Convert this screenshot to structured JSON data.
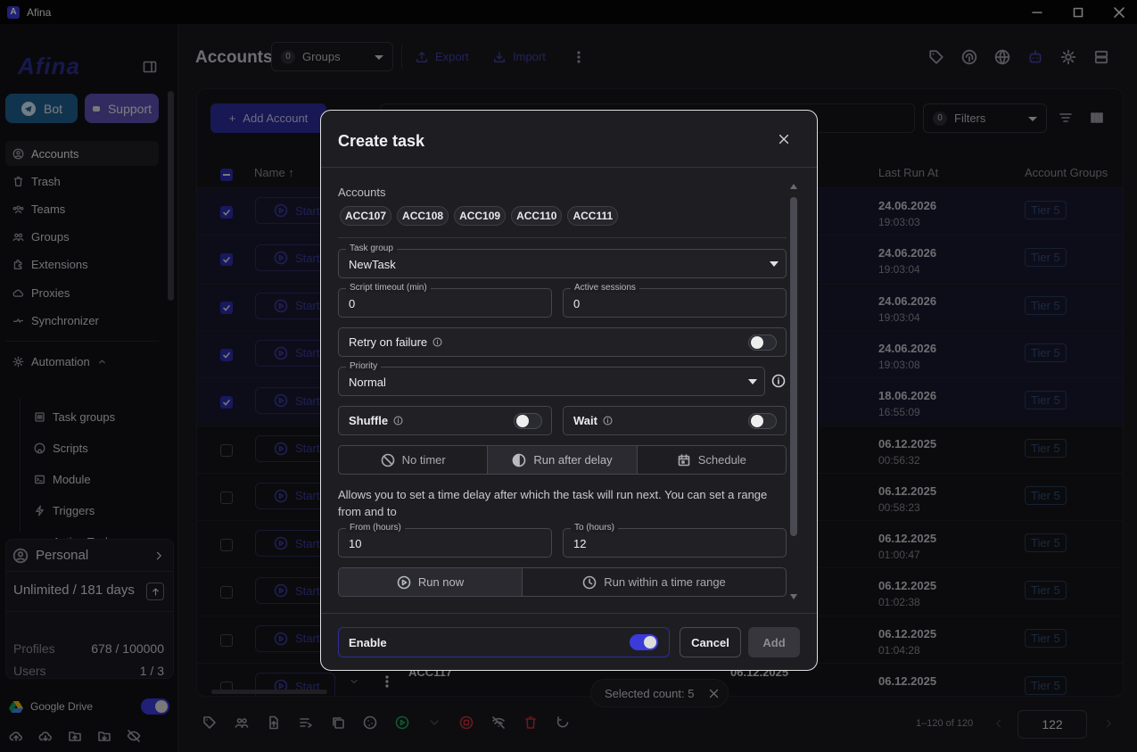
{
  "window": {
    "title": "Afina"
  },
  "sidebar": {
    "brand": "Afina",
    "bot_label": "Bot",
    "support_label": "Support",
    "nav": [
      {
        "label": "Accounts",
        "icon": "user-circle-icon"
      },
      {
        "label": "Trash",
        "icon": "trash-icon"
      },
      {
        "label": "Teams",
        "icon": "teams-icon"
      },
      {
        "label": "Groups",
        "icon": "groups-icon"
      },
      {
        "label": "Extensions",
        "icon": "puzzle-icon"
      },
      {
        "label": "Proxies",
        "icon": "cloud-icon"
      },
      {
        "label": "Synchronizer",
        "icon": "sync-icon"
      }
    ],
    "automation_label": "Automation",
    "automation_items": [
      {
        "label": "Task groups",
        "icon": "list-icon"
      },
      {
        "label": "Scripts",
        "icon": "github-icon"
      },
      {
        "label": "Module",
        "icon": "terminal-icon"
      },
      {
        "label": "Triggers",
        "icon": "bolt-icon"
      },
      {
        "label": "Active Task",
        "icon": "active-list-icon"
      }
    ],
    "plan": {
      "workspace": "Personal",
      "license": "Unlimited / 181 days",
      "profiles_label": "Profiles",
      "profiles_value": "678 / 100000",
      "users_label": "Users",
      "users_value": "1 / 3"
    },
    "google_drive_label": "Google Drive"
  },
  "header": {
    "title": "Accounts",
    "groups_count": "0",
    "groups_label": "Groups",
    "export_label": "Export",
    "import_label": "Import"
  },
  "table": {
    "add_account_label": "Add Account",
    "filters_count": "0",
    "filters_label": "Filters",
    "col_name": "Name ↑",
    "col_last_run": "Last Run At",
    "col_groups": "Account Groups",
    "start_label": "Start",
    "rows": [
      {
        "selected": true,
        "date": "24.06.2026",
        "time": "19:03:03",
        "group": "Tier 5"
      },
      {
        "selected": true,
        "date": "24.06.2026",
        "time": "19:03:04",
        "group": "Tier 5"
      },
      {
        "selected": true,
        "date": "24.06.2026",
        "time": "19:03:04",
        "group": "Tier 5"
      },
      {
        "selected": true,
        "date": "24.06.2026",
        "time": "19:03:08",
        "group": "Tier 5"
      },
      {
        "selected": true,
        "date": "18.06.2026",
        "time": "16:55:09",
        "group": "Tier 5"
      },
      {
        "selected": false,
        "date": "06.12.2025",
        "time": "00:56:32",
        "group": "Tier 5"
      },
      {
        "selected": false,
        "date": "06.12.2025",
        "time": "00:58:23",
        "group": "Tier 5"
      },
      {
        "selected": false,
        "date": "06.12.2025",
        "time": "01:00:47",
        "group": "Tier 5"
      },
      {
        "selected": false,
        "date": "06.12.2025",
        "time": "01:02:38",
        "group": "Tier 5"
      },
      {
        "selected": false,
        "date": "06.12.2025",
        "time": "01:04:28",
        "group": "Tier 5"
      },
      {
        "selected": false,
        "date": "06.12.2025",
        "time": "",
        "group": "Tier 5"
      }
    ],
    "last_row_name": "ACC117",
    "last_row_created": "06.12.2025"
  },
  "footer": {
    "range": "1–120 of 120",
    "page": "122",
    "selected_count": "Selected count: 5"
  },
  "modal": {
    "title": "Create task",
    "accounts_label": "Accounts",
    "accounts": [
      "ACC107",
      "ACC108",
      "ACC109",
      "ACC110",
      "ACC111"
    ],
    "task_group_label": "Task group",
    "task_group_value": "NewTask",
    "timeout_label": "Script timeout (min)",
    "timeout_value": "0",
    "sessions_label": "Active sessions",
    "sessions_value": "0",
    "retry_label": "Retry on failure",
    "priority_label": "Priority",
    "priority_value": "Normal",
    "shuffle_label": "Shuffle",
    "wait_label": "Wait",
    "timer_options": [
      "No timer",
      "Run after delay",
      "Schedule"
    ],
    "timer_selected": "Run after delay",
    "help_text": "Allows you to set a time delay after which the task will run next. You can set a range from and to",
    "from_label": "From (hours)",
    "from_value": "10",
    "to_label": "To (hours)",
    "to_value": "12",
    "run_options": [
      "Run now",
      "Run within a time range"
    ],
    "enable_label": "Enable",
    "cancel_label": "Cancel",
    "add_label": "Add"
  },
  "colors": {
    "accent": "#3b3bd9",
    "background": "#1a1a1f",
    "modal": "#1e1e22"
  }
}
